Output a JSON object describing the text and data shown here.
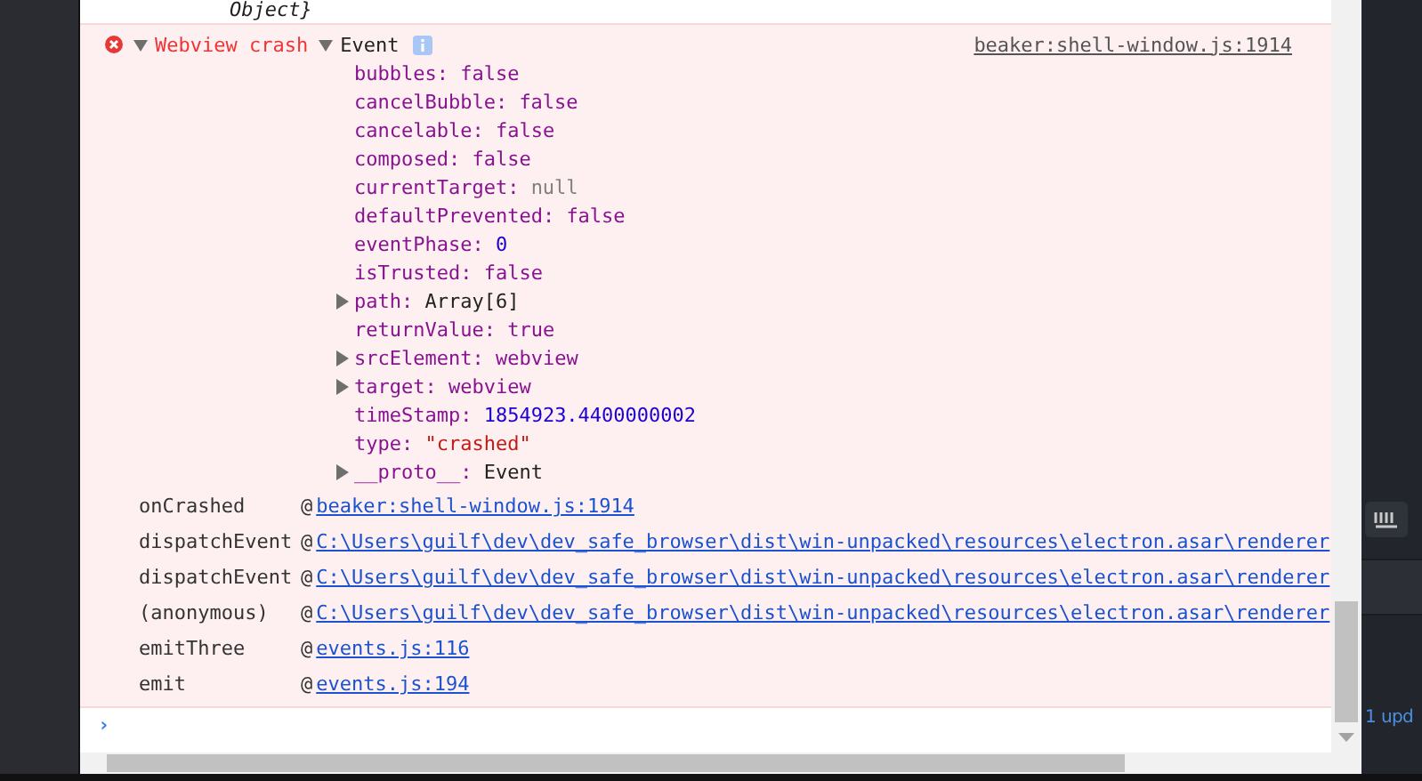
{
  "previous_line": {
    "text": "Object}"
  },
  "error": {
    "message": "Webview crash",
    "expanded": true,
    "object_label": "Event",
    "source": "beaker:shell-window.js:1914",
    "properties": [
      {
        "name": "bubbles:",
        "value": "false",
        "kind": "boolean",
        "expandable": false
      },
      {
        "name": "cancelBubble:",
        "value": "false",
        "kind": "boolean",
        "expandable": false
      },
      {
        "name": "cancelable:",
        "value": "false",
        "kind": "boolean",
        "expandable": false
      },
      {
        "name": "composed:",
        "value": "false",
        "kind": "boolean",
        "expandable": false
      },
      {
        "name": "currentTarget:",
        "value": "null",
        "kind": "null",
        "expandable": false
      },
      {
        "name": "defaultPrevented:",
        "value": "false",
        "kind": "boolean",
        "expandable": false
      },
      {
        "name": "eventPhase:",
        "value": "0",
        "kind": "number",
        "expandable": false
      },
      {
        "name": "isTrusted:",
        "value": "false",
        "kind": "boolean",
        "expandable": false
      },
      {
        "name": "path:",
        "value": "Array[6]",
        "kind": "object",
        "expandable": true
      },
      {
        "name": "returnValue:",
        "value": "true",
        "kind": "boolean",
        "expandable": false
      },
      {
        "name": "srcElement:",
        "value": "webview",
        "kind": "node",
        "expandable": true
      },
      {
        "name": "target:",
        "value": "webview",
        "kind": "node",
        "expandable": true
      },
      {
        "name": "timeStamp:",
        "value": "1854923.4400000002",
        "kind": "number",
        "expandable": false
      },
      {
        "name": "type:",
        "value": "\"crashed\"",
        "kind": "string",
        "expandable": false
      },
      {
        "name": "__proto__:",
        "value": "Event",
        "kind": "object",
        "expandable": true
      }
    ],
    "stack": [
      {
        "function": "onCrashed",
        "at": "@",
        "location": "beaker:shell-window.js:1914"
      },
      {
        "function": "dispatchEvent",
        "at": "@",
        "location": "C:\\Users\\guilf\\dev\\dev_safe_browser\\dist\\win-unpacked\\resources\\electron.asar\\renderer"
      },
      {
        "function": "dispatchEvent",
        "at": "@",
        "location": "C:\\Users\\guilf\\dev\\dev_safe_browser\\dist\\win-unpacked\\resources\\electron.asar\\renderer"
      },
      {
        "function": "(anonymous)",
        "at": "@",
        "location": "C:\\Users\\guilf\\dev\\dev_safe_browser\\dist\\win-unpacked\\resources\\electron.asar\\renderer"
      },
      {
        "function": "emitThree",
        "at": "@",
        "location": "events.js:116"
      },
      {
        "function": "emit",
        "at": "@",
        "location": "events.js:194"
      }
    ]
  },
  "prompt": {
    "symbol": "›"
  },
  "side_panel": {
    "status_text": "1 upd"
  }
}
